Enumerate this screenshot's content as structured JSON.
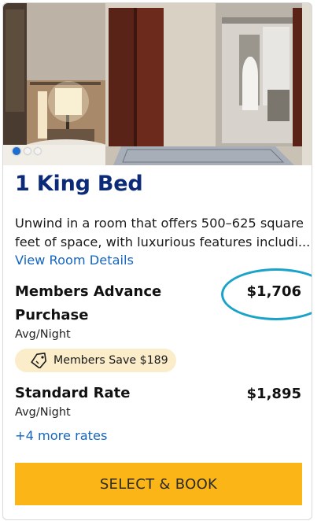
{
  "room": {
    "title": "1 King Bed",
    "description_lines": [
      "Unwind in a room that offers 500–625 square",
      "feet of space, with luxurious features includi..."
    ],
    "details_link": "View Room Details",
    "carousel": {
      "total_slides": 3,
      "active_slide": 1
    }
  },
  "rates": [
    {
      "name_lines": [
        "Members Advance",
        "Purchase"
      ],
      "price": "$1,706",
      "unit": "Avg/Night",
      "badge": "Members Save $189",
      "highlighted": true
    },
    {
      "name_lines": [
        "Standard Rate"
      ],
      "price": "$1,895",
      "unit": "Avg/Night"
    }
  ],
  "more_rates_link": "+4 more rates",
  "cta_label": "SELECT & BOOK",
  "colors": {
    "title": "#0b2a78",
    "link": "#1565c0",
    "badge_bg": "#fbedc9",
    "cta_bg": "#fbb516",
    "highlight_circle": "#1aa3c8",
    "carousel_active_dot": "#1c6fd1"
  },
  "icons": {
    "badge_icon": "price-tag-icon"
  }
}
